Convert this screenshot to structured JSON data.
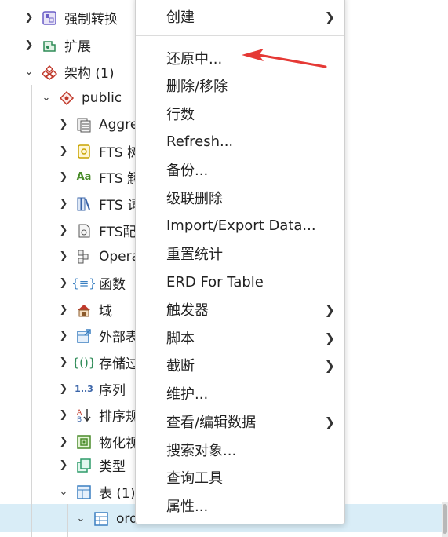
{
  "tree": {
    "items": [
      {
        "label": "强制转换",
        "icon": "cast-icon"
      },
      {
        "label": "扩展",
        "icon": "extension-icon"
      },
      {
        "label": "架构 (1)",
        "icon": "schema-icon"
      },
      {
        "label": "public",
        "icon": "public-schema-icon"
      },
      {
        "label": "Aggre",
        "icon": "aggregate-icon"
      },
      {
        "label": "FTS 树",
        "icon": "fts-config-icon"
      },
      {
        "label": "FTS 解",
        "icon": "fts-parser-icon"
      },
      {
        "label": "FTS 词",
        "icon": "fts-dictionary-icon"
      },
      {
        "label": "FTS配",
        "icon": "fts-template-icon"
      },
      {
        "label": "Opera",
        "icon": "operator-icon"
      },
      {
        "label": "函数",
        "icon": "function-icon"
      },
      {
        "label": "域",
        "icon": "domain-icon"
      },
      {
        "label": "外部表",
        "icon": "foreign-table-icon"
      },
      {
        "label": "存储过",
        "icon": "procedure-icon"
      },
      {
        "label": "序列",
        "icon": "sequence-icon"
      },
      {
        "label": "排序规",
        "icon": "collation-icon"
      },
      {
        "label": "物化视",
        "icon": "materialized-view-icon"
      },
      {
        "label": "类型",
        "icon": "type-icon"
      },
      {
        "label": "表 (1)",
        "icon": "tables-icon"
      },
      {
        "label": "ord",
        "icon": "table-icon"
      }
    ]
  },
  "menu": {
    "items": [
      {
        "label": "创建",
        "submenu": true
      },
      {
        "label": "还原中...",
        "submenu": false
      },
      {
        "label": "删除/移除",
        "submenu": false
      },
      {
        "label": "行数",
        "submenu": false
      },
      {
        "label": "Refresh...",
        "submenu": false
      },
      {
        "label": "备份...",
        "submenu": false
      },
      {
        "label": "级联删除",
        "submenu": false
      },
      {
        "label": "Import/Export Data...",
        "submenu": false
      },
      {
        "label": "重置统计",
        "submenu": false
      },
      {
        "label": "ERD For Table",
        "submenu": false
      },
      {
        "label": "触发器",
        "submenu": true
      },
      {
        "label": "脚本",
        "submenu": true
      },
      {
        "label": "截断",
        "submenu": true
      },
      {
        "label": "维护...",
        "submenu": false
      },
      {
        "label": "查看/编辑数据",
        "submenu": true
      },
      {
        "label": "搜索对象...",
        "submenu": false
      },
      {
        "label": "查询工具",
        "submenu": false
      },
      {
        "label": "属性...",
        "submenu": false
      }
    ]
  },
  "colors": {
    "selection": "#d9edf7",
    "annotation_arrow": "#e53935"
  }
}
